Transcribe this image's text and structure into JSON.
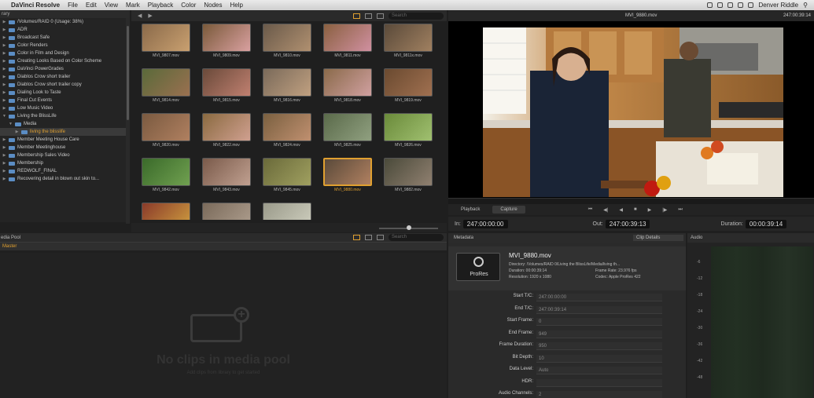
{
  "menubar": {
    "app": "DaVinci Resolve",
    "items": [
      "File",
      "Edit",
      "View",
      "Mark",
      "Playback",
      "Color",
      "Nodes",
      "Help"
    ],
    "user": "Denver Riddle"
  },
  "library": {
    "title": "rary",
    "items": [
      {
        "label": "/Volumes/RAID 0 (Usage: 38%)",
        "level": 0,
        "root": true
      },
      {
        "label": "ADR",
        "level": 0
      },
      {
        "label": "Broadcast Safe",
        "level": 0
      },
      {
        "label": "Color Renders",
        "level": 0
      },
      {
        "label": "Color in Film and Design",
        "level": 0
      },
      {
        "label": "Creating Looks Based on Color Scheme",
        "level": 0
      },
      {
        "label": "DaVinci PowerGrades",
        "level": 0
      },
      {
        "label": "Diablos Crow short trailer",
        "level": 0
      },
      {
        "label": "Diablos Crow short trailer copy",
        "level": 0
      },
      {
        "label": "Dialing Look to Taste",
        "level": 0
      },
      {
        "label": "Final Cut Events",
        "level": 0
      },
      {
        "label": "Low Music Video",
        "level": 0
      },
      {
        "label": "Living the BlissLife",
        "level": 0,
        "open": true
      },
      {
        "label": "Media",
        "level": 1,
        "open": true
      },
      {
        "label": "living the blisslife",
        "level": 2,
        "selected": true
      },
      {
        "label": "Member Meeting House Care",
        "level": 0
      },
      {
        "label": "Member Meetinghouse",
        "level": 0
      },
      {
        "label": "Membership Sales Video",
        "level": 0
      },
      {
        "label": "Membership",
        "level": 0
      },
      {
        "label": "REDWOLF_FINAL",
        "level": 0
      },
      {
        "label": "Recovering detail in blown out skin to...",
        "level": 0
      }
    ]
  },
  "browser": {
    "search_placeholder": "Search",
    "thumbs": [
      {
        "cap": "MVI_9807.mov",
        "c1": "#8a6a4a",
        "c2": "#c9a070"
      },
      {
        "cap": "MVI_9809.mov",
        "c1": "#7a5a3a",
        "c2": "#d9a0a0"
      },
      {
        "cap": "MVI_9810.mov",
        "c1": "#6a5a4a",
        "c2": "#b09070"
      },
      {
        "cap": "MVI_9811.mov",
        "c1": "#8a6040",
        "c2": "#d090a0"
      },
      {
        "cap": "MVI_9811x.mov",
        "c1": "#5a4a3a",
        "c2": "#a08060"
      },
      {
        "cap": "MVI_9814.mov",
        "c1": "#5a6a3a",
        "c2": "#9a7050"
      },
      {
        "cap": "MVI_9815.mov",
        "c1": "#6a4a3a",
        "c2": "#c08070"
      },
      {
        "cap": "MVI_9816.mov",
        "c1": "#7a6a5a",
        "c2": "#c0a080"
      },
      {
        "cap": "MVI_9818.mov",
        "c1": "#8a6a4a",
        "c2": "#d0a0a0"
      },
      {
        "cap": "MVI_9819.mov",
        "c1": "#6a4a30",
        "c2": "#a07050"
      },
      {
        "cap": "MVI_9820.mov",
        "c1": "#7a5a40",
        "c2": "#b08060"
      },
      {
        "cap": "MVI_9822.mov",
        "c1": "#8a6a40",
        "c2": "#d0a090"
      },
      {
        "cap": "MVI_9824.mov",
        "c1": "#7a6040",
        "c2": "#c09070"
      },
      {
        "cap": "MVI_9825.mov",
        "c1": "#5a6a4a",
        "c2": "#90a080"
      },
      {
        "cap": "MVI_9826.mov",
        "c1": "#6a8a3a",
        "c2": "#a0c070"
      },
      {
        "cap": "MVI_9842.mov",
        "c1": "#3a6a2a",
        "c2": "#70a050"
      },
      {
        "cap": "MVI_9843.mov",
        "c1": "#7a5a4a",
        "c2": "#c0a090"
      },
      {
        "cap": "MVI_9845.mov",
        "c1": "#6a6a3a",
        "c2": "#a0a060"
      },
      {
        "cap": "MVI_9880.mov",
        "c1": "#5a4a3a",
        "c2": "#b08060",
        "selected": true
      },
      {
        "cap": "MVI_9882.mov",
        "c1": "#4a4a3a",
        "c2": "#908070"
      },
      {
        "cap": "",
        "c1": "#8a3a2a",
        "c2": "#d0a040"
      },
      {
        "cap": "",
        "c1": "#7a6a5a",
        "c2": "#b0a090"
      },
      {
        "cap": "",
        "c1": "#9a9a8a",
        "c2": "#d0d0c0"
      }
    ]
  },
  "viewer": {
    "clip_name": "MVI_9880.mov",
    "timecode": "247:00:39:14",
    "tabs": [
      "Playback",
      "Capture"
    ],
    "in_label": "In:",
    "in_tc": "247:00:00:00",
    "out_label": "Out:",
    "out_tc": "247:00:39:13",
    "duration_label": "Duration:",
    "duration_tc": "00:00:39:14"
  },
  "media_pool": {
    "title": "edia Pool",
    "master": "Master",
    "empty_title": "No clips in media pool",
    "empty_sub": "Add clips from library to get started"
  },
  "metadata": {
    "title": "Metadata",
    "dropdown": "Clip Details",
    "codec_badge": "ProRes",
    "file_name": "MVI_9880.mov",
    "directory": "Directory:   /Volumes/RAID 0/Living the BlissLife/Media/living th...",
    "duration": "Duration:    00:00:39:14",
    "frame_rate": "Frame Rate:  23.976 fps",
    "resolution": "Resolution:  1920 x 1080",
    "codec": "Codec:  Apple ProRes 422",
    "props": [
      {
        "k": "Start T/C:",
        "v": "247:00:00:00"
      },
      {
        "k": "End T/C:",
        "v": "247:00:39:14"
      },
      {
        "k": "Start Frame:",
        "v": "0"
      },
      {
        "k": "End Frame:",
        "v": "949"
      },
      {
        "k": "Frame Duration:",
        "v": "950"
      },
      {
        "k": "Bit Depth:",
        "v": "10"
      },
      {
        "k": "Data Level:",
        "v": "Auto"
      },
      {
        "k": "HDR:",
        "v": ""
      },
      {
        "k": "Audio Channels:",
        "v": "2"
      }
    ]
  },
  "audio": {
    "title": "Audio",
    "scale": [
      "-6",
      "-12",
      "-18",
      "-24",
      "-30",
      "-36",
      "-42",
      "-48"
    ]
  }
}
